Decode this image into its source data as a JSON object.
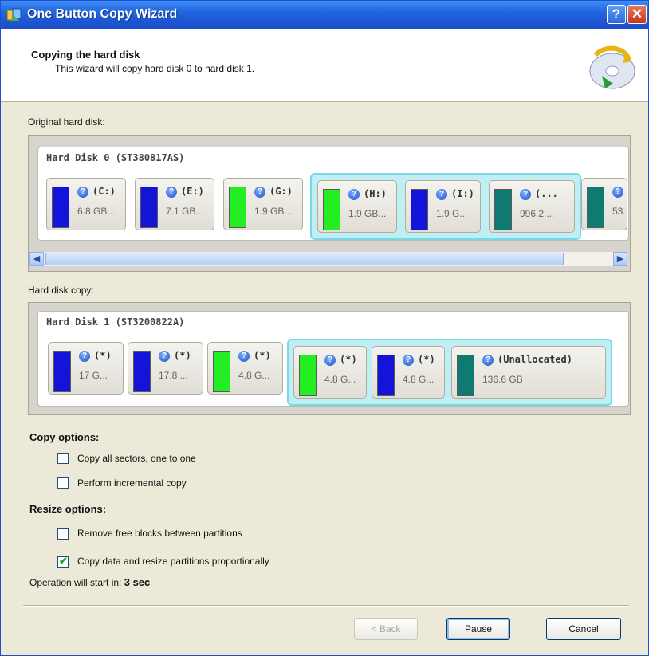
{
  "window": {
    "title": "One Button Copy Wizard",
    "help_glyph": "?",
    "close_glyph": "✕"
  },
  "header": {
    "title": "Copying the hard disk",
    "subtitle": "This wizard will copy hard disk 0 to hard disk 1."
  },
  "original": {
    "label": "Original hard disk:",
    "disk_title": "Hard Disk 0 (ST380817AS)",
    "partitions": [
      {
        "label": "(C:)",
        "size": "6.8 GB...",
        "color": "#1414d8"
      },
      {
        "label": "(E:)",
        "size": "7.1 GB...",
        "color": "#1414d8"
      },
      {
        "label": "(G:)",
        "size": "1.9 GB...",
        "color": "#22ee22"
      },
      {
        "label": "(H:)",
        "size": "1.9 GB...",
        "color": "#22ee22"
      },
      {
        "label": "(I:)",
        "size": "1.9 G...",
        "color": "#1414d8"
      },
      {
        "label": "(...",
        "size": "996.2 ...",
        "color": "#0f7a72"
      },
      {
        "label": "",
        "size": "53.",
        "color": "#0f7a72"
      }
    ]
  },
  "copy": {
    "label": "Hard disk copy:",
    "disk_title": "Hard Disk 1 (ST3200822A)",
    "partitions": [
      {
        "label": "(*)",
        "size": "17 G...",
        "color": "#1414d8"
      },
      {
        "label": "(*)",
        "size": "17.8 ...",
        "color": "#1414d8"
      },
      {
        "label": "(*)",
        "size": "4.8 G...",
        "color": "#22ee22"
      },
      {
        "label": "(*)",
        "size": "4.8 G...",
        "color": "#22ee22"
      },
      {
        "label": "(*)",
        "size": "4.8 G...",
        "color": "#1414d8"
      },
      {
        "label": "(Unallocated)",
        "size": "136.6 GB",
        "color": "#0f7a72"
      }
    ]
  },
  "copy_options": {
    "title": "Copy options:",
    "items": [
      {
        "label": "Copy all sectors, one to one",
        "checked": false
      },
      {
        "label": "Perform incremental copy",
        "checked": false
      }
    ]
  },
  "resize_options": {
    "title": "Resize options:",
    "items": [
      {
        "label": "Remove free blocks between partitions",
        "checked": false
      },
      {
        "label": "Copy data and resize partitions proportionally",
        "checked": true
      }
    ]
  },
  "status": {
    "prefix": "Operation will start in:",
    "countdown": "3 sec"
  },
  "buttons": {
    "back": "< Back",
    "pause": "Pause",
    "cancel": "Cancel"
  }
}
